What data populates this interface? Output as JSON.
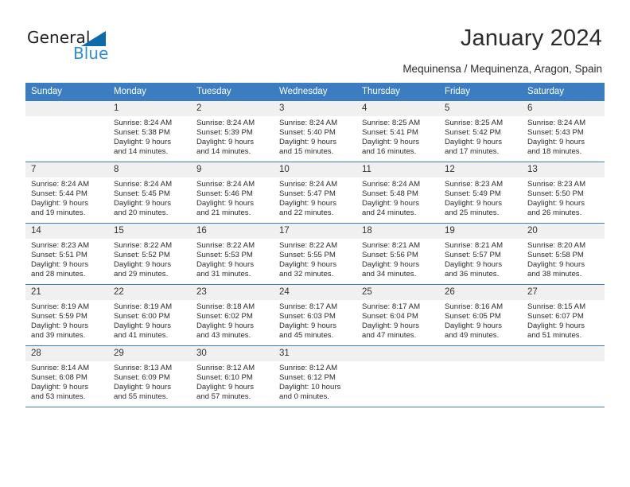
{
  "brand": {
    "name_part1": "General",
    "name_part2": "Blue",
    "accent_color": "#2e8fd6",
    "triangle_color": "#0d6aad"
  },
  "header": {
    "title": "January 2024",
    "subtitle": "Mequinensa / Mequinenza, Aragon, Spain"
  },
  "calendar": {
    "header_color": "#3b7dc0",
    "daynum_bg": "#f0f0f0",
    "weekday_headers": [
      "Sunday",
      "Monday",
      "Tuesday",
      "Wednesday",
      "Thursday",
      "Friday",
      "Saturday"
    ],
    "weeks": [
      [
        {
          "day": "",
          "sunrise": "",
          "sunset": "",
          "daylight1": "",
          "daylight2": ""
        },
        {
          "day": "1",
          "sunrise": "Sunrise: 8:24 AM",
          "sunset": "Sunset: 5:38 PM",
          "daylight1": "Daylight: 9 hours",
          "daylight2": "and 14 minutes."
        },
        {
          "day": "2",
          "sunrise": "Sunrise: 8:24 AM",
          "sunset": "Sunset: 5:39 PM",
          "daylight1": "Daylight: 9 hours",
          "daylight2": "and 14 minutes."
        },
        {
          "day": "3",
          "sunrise": "Sunrise: 8:24 AM",
          "sunset": "Sunset: 5:40 PM",
          "daylight1": "Daylight: 9 hours",
          "daylight2": "and 15 minutes."
        },
        {
          "day": "4",
          "sunrise": "Sunrise: 8:25 AM",
          "sunset": "Sunset: 5:41 PM",
          "daylight1": "Daylight: 9 hours",
          "daylight2": "and 16 minutes."
        },
        {
          "day": "5",
          "sunrise": "Sunrise: 8:25 AM",
          "sunset": "Sunset: 5:42 PM",
          "daylight1": "Daylight: 9 hours",
          "daylight2": "and 17 minutes."
        },
        {
          "day": "6",
          "sunrise": "Sunrise: 8:24 AM",
          "sunset": "Sunset: 5:43 PM",
          "daylight1": "Daylight: 9 hours",
          "daylight2": "and 18 minutes."
        }
      ],
      [
        {
          "day": "7",
          "sunrise": "Sunrise: 8:24 AM",
          "sunset": "Sunset: 5:44 PM",
          "daylight1": "Daylight: 9 hours",
          "daylight2": "and 19 minutes."
        },
        {
          "day": "8",
          "sunrise": "Sunrise: 8:24 AM",
          "sunset": "Sunset: 5:45 PM",
          "daylight1": "Daylight: 9 hours",
          "daylight2": "and 20 minutes."
        },
        {
          "day": "9",
          "sunrise": "Sunrise: 8:24 AM",
          "sunset": "Sunset: 5:46 PM",
          "daylight1": "Daylight: 9 hours",
          "daylight2": "and 21 minutes."
        },
        {
          "day": "10",
          "sunrise": "Sunrise: 8:24 AM",
          "sunset": "Sunset: 5:47 PM",
          "daylight1": "Daylight: 9 hours",
          "daylight2": "and 22 minutes."
        },
        {
          "day": "11",
          "sunrise": "Sunrise: 8:24 AM",
          "sunset": "Sunset: 5:48 PM",
          "daylight1": "Daylight: 9 hours",
          "daylight2": "and 24 minutes."
        },
        {
          "day": "12",
          "sunrise": "Sunrise: 8:23 AM",
          "sunset": "Sunset: 5:49 PM",
          "daylight1": "Daylight: 9 hours",
          "daylight2": "and 25 minutes."
        },
        {
          "day": "13",
          "sunrise": "Sunrise: 8:23 AM",
          "sunset": "Sunset: 5:50 PM",
          "daylight1": "Daylight: 9 hours",
          "daylight2": "and 26 minutes."
        }
      ],
      [
        {
          "day": "14",
          "sunrise": "Sunrise: 8:23 AM",
          "sunset": "Sunset: 5:51 PM",
          "daylight1": "Daylight: 9 hours",
          "daylight2": "and 28 minutes."
        },
        {
          "day": "15",
          "sunrise": "Sunrise: 8:22 AM",
          "sunset": "Sunset: 5:52 PM",
          "daylight1": "Daylight: 9 hours",
          "daylight2": "and 29 minutes."
        },
        {
          "day": "16",
          "sunrise": "Sunrise: 8:22 AM",
          "sunset": "Sunset: 5:53 PM",
          "daylight1": "Daylight: 9 hours",
          "daylight2": "and 31 minutes."
        },
        {
          "day": "17",
          "sunrise": "Sunrise: 8:22 AM",
          "sunset": "Sunset: 5:55 PM",
          "daylight1": "Daylight: 9 hours",
          "daylight2": "and 32 minutes."
        },
        {
          "day": "18",
          "sunrise": "Sunrise: 8:21 AM",
          "sunset": "Sunset: 5:56 PM",
          "daylight1": "Daylight: 9 hours",
          "daylight2": "and 34 minutes."
        },
        {
          "day": "19",
          "sunrise": "Sunrise: 8:21 AM",
          "sunset": "Sunset: 5:57 PM",
          "daylight1": "Daylight: 9 hours",
          "daylight2": "and 36 minutes."
        },
        {
          "day": "20",
          "sunrise": "Sunrise: 8:20 AM",
          "sunset": "Sunset: 5:58 PM",
          "daylight1": "Daylight: 9 hours",
          "daylight2": "and 38 minutes."
        }
      ],
      [
        {
          "day": "21",
          "sunrise": "Sunrise: 8:19 AM",
          "sunset": "Sunset: 5:59 PM",
          "daylight1": "Daylight: 9 hours",
          "daylight2": "and 39 minutes."
        },
        {
          "day": "22",
          "sunrise": "Sunrise: 8:19 AM",
          "sunset": "Sunset: 6:00 PM",
          "daylight1": "Daylight: 9 hours",
          "daylight2": "and 41 minutes."
        },
        {
          "day": "23",
          "sunrise": "Sunrise: 8:18 AM",
          "sunset": "Sunset: 6:02 PM",
          "daylight1": "Daylight: 9 hours",
          "daylight2": "and 43 minutes."
        },
        {
          "day": "24",
          "sunrise": "Sunrise: 8:17 AM",
          "sunset": "Sunset: 6:03 PM",
          "daylight1": "Daylight: 9 hours",
          "daylight2": "and 45 minutes."
        },
        {
          "day": "25",
          "sunrise": "Sunrise: 8:17 AM",
          "sunset": "Sunset: 6:04 PM",
          "daylight1": "Daylight: 9 hours",
          "daylight2": "and 47 minutes."
        },
        {
          "day": "26",
          "sunrise": "Sunrise: 8:16 AM",
          "sunset": "Sunset: 6:05 PM",
          "daylight1": "Daylight: 9 hours",
          "daylight2": "and 49 minutes."
        },
        {
          "day": "27",
          "sunrise": "Sunrise: 8:15 AM",
          "sunset": "Sunset: 6:07 PM",
          "daylight1": "Daylight: 9 hours",
          "daylight2": "and 51 minutes."
        }
      ],
      [
        {
          "day": "28",
          "sunrise": "Sunrise: 8:14 AM",
          "sunset": "Sunset: 6:08 PM",
          "daylight1": "Daylight: 9 hours",
          "daylight2": "and 53 minutes."
        },
        {
          "day": "29",
          "sunrise": "Sunrise: 8:13 AM",
          "sunset": "Sunset: 6:09 PM",
          "daylight1": "Daylight: 9 hours",
          "daylight2": "and 55 minutes."
        },
        {
          "day": "30",
          "sunrise": "Sunrise: 8:12 AM",
          "sunset": "Sunset: 6:10 PM",
          "daylight1": "Daylight: 9 hours",
          "daylight2": "and 57 minutes."
        },
        {
          "day": "31",
          "sunrise": "Sunrise: 8:12 AM",
          "sunset": "Sunset: 6:12 PM",
          "daylight1": "Daylight: 10 hours",
          "daylight2": "and 0 minutes."
        },
        {
          "day": "",
          "sunrise": "",
          "sunset": "",
          "daylight1": "",
          "daylight2": ""
        },
        {
          "day": "",
          "sunrise": "",
          "sunset": "",
          "daylight1": "",
          "daylight2": ""
        },
        {
          "day": "",
          "sunrise": "",
          "sunset": "",
          "daylight1": "",
          "daylight2": ""
        }
      ]
    ]
  }
}
